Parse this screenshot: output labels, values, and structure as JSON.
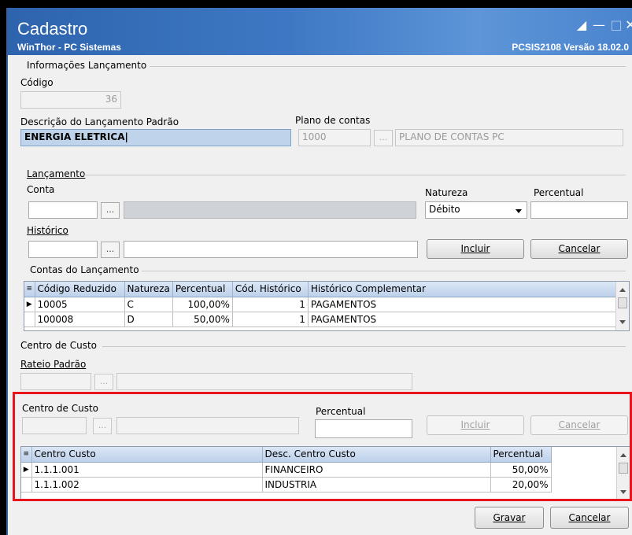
{
  "window": {
    "title": "Cadastro",
    "subtitle": "WinThor - PC Sistemas",
    "version": "PCSIS2108  Versão 18.02.0"
  },
  "info": {
    "group_label": "Informações Lançamento",
    "codigo_label": "Código",
    "codigo_value": "36",
    "descricao_label": "Descrição do Lançamento Padrão",
    "descricao_value": "ENERGIA ELETRICA",
    "plano_label": "Plano de contas",
    "plano_code": "1000",
    "plano_name": "PLANO DE CONTAS PC"
  },
  "lancamento": {
    "group_label": "Lançamento",
    "conta_label": "Conta",
    "conta_value": "",
    "natureza_label": "Natureza",
    "natureza_value": "Débito",
    "percentual_label": "Percentual",
    "percentual_value": "",
    "historico_label": "Histórico",
    "incluir_label": "Incluir",
    "cancelar_label": "Cancelar",
    "ellipsis": "..."
  },
  "contas": {
    "group_label": "Contas do Lançamento",
    "columns": [
      "Código Reduzido",
      "Natureza",
      "Percentual",
      "Cód. Histórico",
      "Histórico Complementar"
    ],
    "rows": [
      {
        "codigo": "10005",
        "natureza": "C",
        "percentual": "100,00%",
        "cod_hist": "1",
        "hist_comp": "PAGAMENTOS"
      },
      {
        "codigo": "100008",
        "natureza": "D",
        "percentual": "50,00%",
        "cod_hist": "1",
        "hist_comp": "PAGAMENTOS"
      }
    ]
  },
  "centro": {
    "group_label": "Centro de Custo",
    "rateio_label": "Rateio Padrão",
    "cc_label": "Centro de Custo",
    "percentual_label": "Percentual",
    "incluir_label": "Incluir",
    "cancelar_label": "Cancelar",
    "columns": [
      "Centro Custo",
      "Desc. Centro Custo",
      "Percentual"
    ],
    "rows": [
      {
        "centro": "1.1.1.001",
        "desc": "FINANCEIRO",
        "percentual": "50,00%"
      },
      {
        "centro": "1.1.1.002",
        "desc": "INDUSTRIA",
        "percentual": "20,00%"
      }
    ]
  },
  "footer": {
    "gravar_label": "Gravar",
    "cancelar_label": "Cancelar"
  },
  "colors": {
    "title_bar": "#3e78c4",
    "highlight_frame": "#e8141c",
    "selected_field": "#bfd4ea"
  }
}
